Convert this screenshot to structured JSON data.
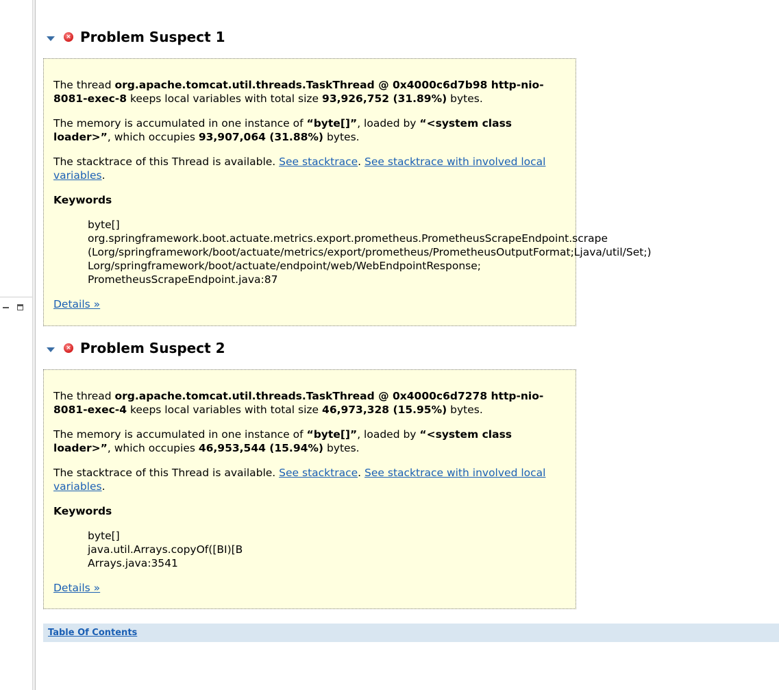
{
  "suspects": [
    {
      "title": "Problem Suspect 1",
      "thread_intro": "The thread ",
      "thread_name": "org.apache.tomcat.util.threads.TaskThread @ 0x4000c6d7b98 http-nio-8081-exec-8",
      "thread_mid": " keeps local variables with total size ",
      "thread_size": "93,926,752 (31.89%)",
      "thread_end": " bytes.",
      "mem_intro": "The memory is accumulated in one instance of ",
      "mem_type": "“byte[]”",
      "mem_loaded": ", loaded by ",
      "mem_loader": "“<system class loader>”",
      "mem_occupies": ", which occupies ",
      "mem_size": "93,907,064 (31.88%)",
      "mem_end": " bytes.",
      "stack_intro": "The stacktrace of this Thread is available. ",
      "stack_link1": "See stacktrace",
      "stack_sep": ". ",
      "stack_link2": "See stacktrace with involved local variables",
      "stack_end": ".",
      "keywords_title": "Keywords",
      "keywords": [
        "byte[]",
        "org.springframework.boot.actuate.metrics.export.prometheus.PrometheusScrapeEndpoint.scrape",
        "(Lorg/springframework/boot/actuate/metrics/export/prometheus/PrometheusOutputFormat;Ljava/util/Set;)",
        "Lorg/springframework/boot/actuate/endpoint/web/WebEndpointResponse;",
        "PrometheusScrapeEndpoint.java:87"
      ],
      "details_label": "Details »"
    },
    {
      "title": "Problem Suspect 2",
      "thread_intro": "The thread ",
      "thread_name": "org.apache.tomcat.util.threads.TaskThread @ 0x4000c6d7278 http-nio-8081-exec-4",
      "thread_mid": " keeps local variables with total size ",
      "thread_size": "46,973,328 (15.95%)",
      "thread_end": " bytes.",
      "mem_intro": "The memory is accumulated in one instance of ",
      "mem_type": "“byte[]”",
      "mem_loaded": ", loaded by ",
      "mem_loader": "“<system class loader>”",
      "mem_occupies": ", which occupies ",
      "mem_size": "46,953,544 (15.94%)",
      "mem_end": " bytes.",
      "stack_intro": "The stacktrace of this Thread is available. ",
      "stack_link1": "See stacktrace",
      "stack_sep": ". ",
      "stack_link2": "See stacktrace with involved local variables",
      "stack_end": ".",
      "keywords_title": "Keywords",
      "keywords": [
        "byte[]",
        "java.util.Arrays.copyOf([BI)[B",
        "Arrays.java:3541"
      ],
      "details_label": "Details »"
    }
  ],
  "toc_label": "Table Of Contents",
  "icons": {
    "collapse": "chevron-down-icon",
    "error": "error-icon",
    "minimize": "minimize-icon",
    "maximize": "maximize-icon"
  },
  "colors": {
    "box_background": "#ffffe0",
    "link": "#1a5fb4",
    "toc_bar": "#d9e6f1",
    "error_red": "#d42020"
  }
}
